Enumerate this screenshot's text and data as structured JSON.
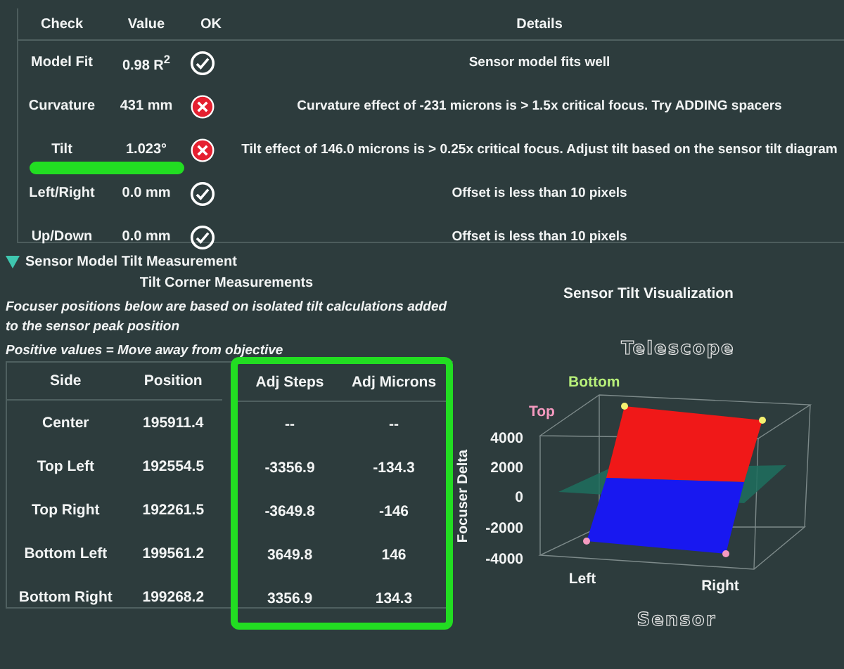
{
  "report": {
    "columns": [
      "Check",
      "Value",
      "OK",
      "Details"
    ],
    "checks": [
      {
        "check": "Model Fit",
        "value": "0.98 R$^{2}$",
        "ok": true,
        "highlighted": false,
        "details": "Sensor model fits well"
      },
      {
        "check": "Curvature",
        "value": "431 mm",
        "ok": false,
        "highlighted": false,
        "details": "Curvature effect of -231 microns is > 1.5x critical focus. Try ADDING spacers"
      },
      {
        "check": "Tilt",
        "value": "1.023°",
        "ok": false,
        "highlighted": true,
        "details": "Tilt effect of 146.0 microns is > 0.25x critical focus. Adjust tilt based on the sensor tilt diagram"
      },
      {
        "check": "Left/Right",
        "value": "0.0 mm",
        "ok": true,
        "highlighted": false,
        "details": "Offset is less than 10 pixels"
      },
      {
        "check": "Up/Down",
        "value": "0.0 mm",
        "ok": true,
        "highlighted": false,
        "details": "Offset is less than 10 pixels"
      }
    ]
  },
  "section": {
    "title": "Sensor Model Tilt Measurement",
    "expanded": true
  },
  "corner": {
    "title": "Tilt Corner Measurements",
    "note": "Focuser positions below are based on isolated tilt calculations added to the sensor peak position",
    "sign_note": "Positive values = Move away from objective",
    "columns": [
      {
        "label": "Side",
        "highlighted": false
      },
      {
        "label": "Position",
        "highlighted": false
      },
      {
        "label": "Adj Steps",
        "highlighted": true
      },
      {
        "label": "Adj Microns",
        "highlighted": true
      }
    ],
    "rows": [
      {
        "cells": [
          "Center",
          "195911.4",
          "--",
          "--"
        ]
      },
      {
        "cells": [
          "Top Left",
          "192554.5",
          "-3356.9",
          "-134.3"
        ]
      },
      {
        "cells": [
          "Top Right",
          "192261.5",
          "-3649.8",
          "-146"
        ]
      },
      {
        "cells": [
          "Bottom Left",
          "199561.2",
          "3649.8",
          "146"
        ]
      },
      {
        "cells": [
          "Bottom Right",
          "199268.2",
          "3356.9",
          "134.3"
        ]
      }
    ]
  },
  "plot": {
    "title": "Sensor Tilt Visualization",
    "plot_title": "Telescope",
    "x_label": "Sensor",
    "y_label": "Focuser Delta",
    "y_ticks": [
      "4000",
      "2000",
      "0",
      "-2000",
      "-4000"
    ],
    "x_ticks": [
      "Left",
      "Right"
    ],
    "corner_labels": [
      {
        "text": "Bottom",
        "color": "#b8f07a"
      },
      {
        "text": "Top",
        "color": "#f59ac0"
      }
    ]
  }
}
